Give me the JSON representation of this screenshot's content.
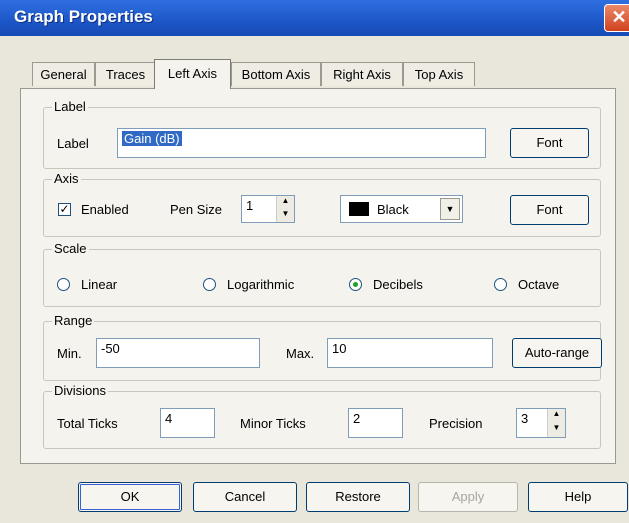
{
  "dialog": {
    "title": "Graph Properties",
    "close_glyph": "✕",
    "tabs": [
      "General",
      "Traces",
      "Left Axis",
      "Bottom Axis",
      "Right Axis",
      "Top Axis"
    ],
    "active_tab": "Left Axis"
  },
  "label_group": {
    "title": "Label",
    "field_label": "Label",
    "value": "Gain (dB)",
    "font_button": "Font"
  },
  "axis_group": {
    "title": "Axis",
    "enabled_label": "Enabled",
    "enabled_checked": true,
    "check_glyph": "✓",
    "pen_size_label": "Pen Size",
    "pen_size_value": "1",
    "color_value": "Black",
    "color_swatch": "#000000",
    "font_button": "Font"
  },
  "scale_group": {
    "title": "Scale",
    "options": [
      {
        "label": "Linear",
        "selected": false
      },
      {
        "label": "Logarithmic",
        "selected": false
      },
      {
        "label": "Decibels",
        "selected": true
      },
      {
        "label": "Octave",
        "selected": false
      }
    ]
  },
  "range_group": {
    "title": "Range",
    "min_label": "Min.",
    "min_value": "-50",
    "max_label": "Max.",
    "max_value": "10",
    "autorange_button": "Auto-range"
  },
  "divisions_group": {
    "title": "Divisions",
    "total_ticks_label": "Total Ticks",
    "total_ticks_value": "4",
    "minor_ticks_label": "Minor Ticks",
    "minor_ticks_value": "2",
    "precision_label": "Precision",
    "precision_value": "3"
  },
  "footer": {
    "ok": "OK",
    "cancel": "Cancel",
    "restore": "Restore",
    "apply": "Apply",
    "help": "Help"
  },
  "icons": {
    "spin_up": "▲",
    "spin_down": "▼",
    "dropdown": "▼"
  }
}
